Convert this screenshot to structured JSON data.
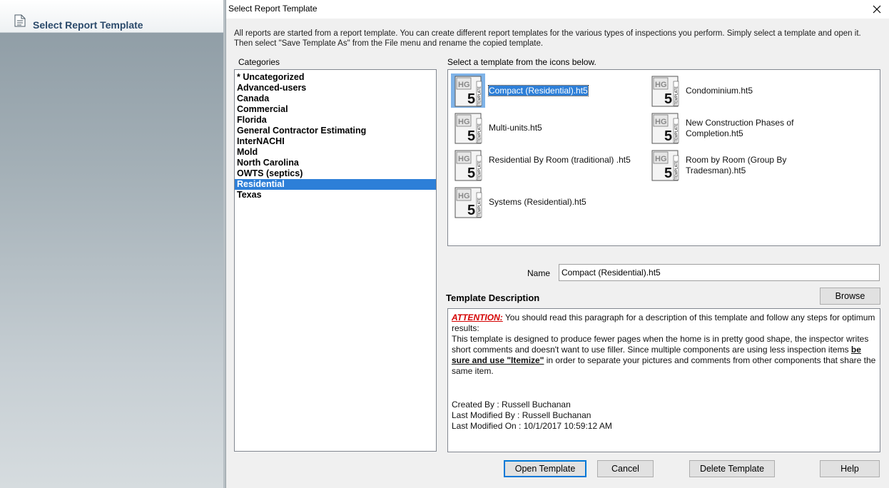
{
  "left_panel": {
    "title": "Select Report Template",
    "icon": "document-icon"
  },
  "dialog": {
    "title": "Select Report Template",
    "close_icon": "close-icon",
    "intro": "All reports are started from a report template. You can create different report templates for the various types of inspections you perform. Simply select a template and open it. Then select \"Save Template As\" from the File menu and rename the copied template.",
    "categories_label": "Categories",
    "categories": [
      "* Uncategorized",
      "Advanced-users",
      "Canada",
      "Commercial",
      "Florida",
      "General Contractor Estimating",
      "InterNACHI",
      "Mold",
      "North Carolina",
      "OWTS (septics)",
      "Residential",
      "Texas"
    ],
    "selected_category": "Residential",
    "templates_label": "Select a template from the icons below.",
    "templates": [
      {
        "label": "Compact (Residential).ht5",
        "selected": true
      },
      {
        "label": "Condominium.ht5",
        "selected": false
      },
      {
        "label": "Multi-units.ht5",
        "selected": false
      },
      {
        "label": "New Construction Phases of Completion.ht5",
        "selected": false
      },
      {
        "label": "Residential By Room (traditional) .ht5",
        "selected": false
      },
      {
        "label": "Room by Room (Group By Tradesman).ht5",
        "selected": false
      },
      {
        "label": "Systems (Residential).ht5",
        "selected": false
      }
    ],
    "template_icon": "hg5-template-icon",
    "name_label": "Name",
    "name_value": "Compact (Residential).ht5",
    "description_label": "Template Description",
    "browse_label": "Browse",
    "description": {
      "attention": "ATTENTION:",
      "intro": " You should read this paragraph for a description of this template and follow any steps for optimum results:",
      "body_before": "This template is designed to produce fewer pages when the home is in pretty good shape, the inspector writes short comments and doesn't want to use filler. Since multiple components are using less inspection items ",
      "body_emphasis": "be sure and use \"Itemize\"",
      "body_after": " in order to separate your pictures and comments from other components that share the same item.",
      "created_by": "Created By : Russell Buchanan",
      "last_modified_by": "Last Modified By : Russell Buchanan",
      "last_modified_on": "Last Modified On : 10/1/2017 10:59:12 AM"
    },
    "buttons": {
      "open": "Open Template",
      "cancel": "Cancel",
      "delete": "Delete Template",
      "help": "Help"
    }
  }
}
